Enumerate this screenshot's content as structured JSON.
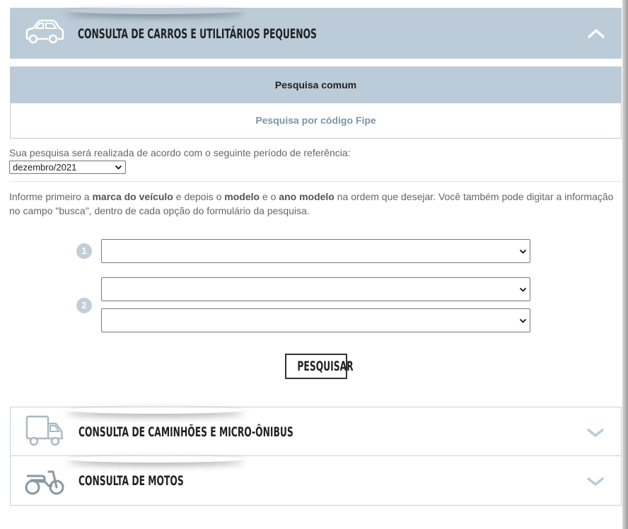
{
  "sections": {
    "cars": {
      "title": "CONSULTA DE CARROS E UTILITÁRIOS PEQUENOS",
      "icon": "car-icon",
      "state": "expanded"
    },
    "trucks": {
      "title": "CONSULTA DE CAMINHÕES E MICRO-ÔNIBUS",
      "icon": "truck-icon",
      "state": "collapsed"
    },
    "motos": {
      "title": "CONSULTA DE MOTOS",
      "icon": "motorcycle-icon",
      "state": "collapsed"
    }
  },
  "tabs": {
    "common": "Pesquisa comum",
    "fipe": "Pesquisa por código Fipe"
  },
  "period": {
    "label": "Sua pesquisa será realizada de acordo com o seguinte período de referência:",
    "selected": "dezembro/2021"
  },
  "info": {
    "t1": "Informe primeiro a ",
    "b1": "marca do veículo",
    "t2": " e depois o ",
    "b2": "modelo",
    "t3": " e o ",
    "b3": "ano modelo",
    "t4": " na ordem que desejar. Você também pode digitar a informação no campo \"busca\", dentro de cada opção do formulário da pesquisa."
  },
  "steps": {
    "one": "1",
    "two": "2"
  },
  "form": {
    "brand": "",
    "model": "",
    "year": ""
  },
  "search_button": "PESQUISAR",
  "colors": {
    "accent": "#bccbd8",
    "tab_inactive_text": "#7d94a8",
    "icon_gray": "#aab8c4"
  }
}
